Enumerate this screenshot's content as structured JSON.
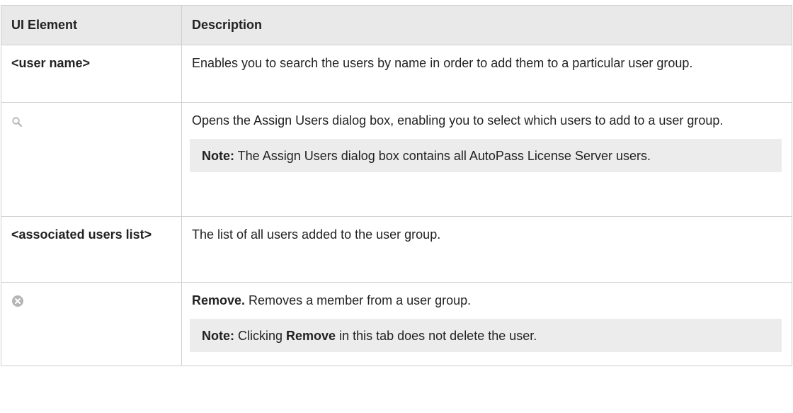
{
  "header": {
    "col_element": "UI Element",
    "col_description": "Description"
  },
  "rows": [
    {
      "element": "<user name>",
      "description": "Enables you to search the users by name in order to add them to a particular user group."
    },
    {
      "element_icon": "search-icon",
      "description": "Opens the Assign Users dialog box, enabling you to select which users to add to a user group.",
      "note_label": "Note:",
      "note_text": " The Assign Users dialog box contains all AutoPass License Server users."
    },
    {
      "element": "<associated users list>",
      "description": "The list of all users added to the user group."
    },
    {
      "element_icon": "remove-icon",
      "description_bold": "Remove.",
      "description": " Removes a member from a user group.",
      "note_label": "Note:",
      "note_prefix": " Clicking ",
      "note_bold": "Remove",
      "note_suffix": " in this tab does not delete the user."
    }
  ],
  "colors": {
    "header_bg": "#e9e9e9",
    "note_bg": "#ececec",
    "border": "#cfcfcf",
    "icon_gray": "#b5b5b5"
  }
}
